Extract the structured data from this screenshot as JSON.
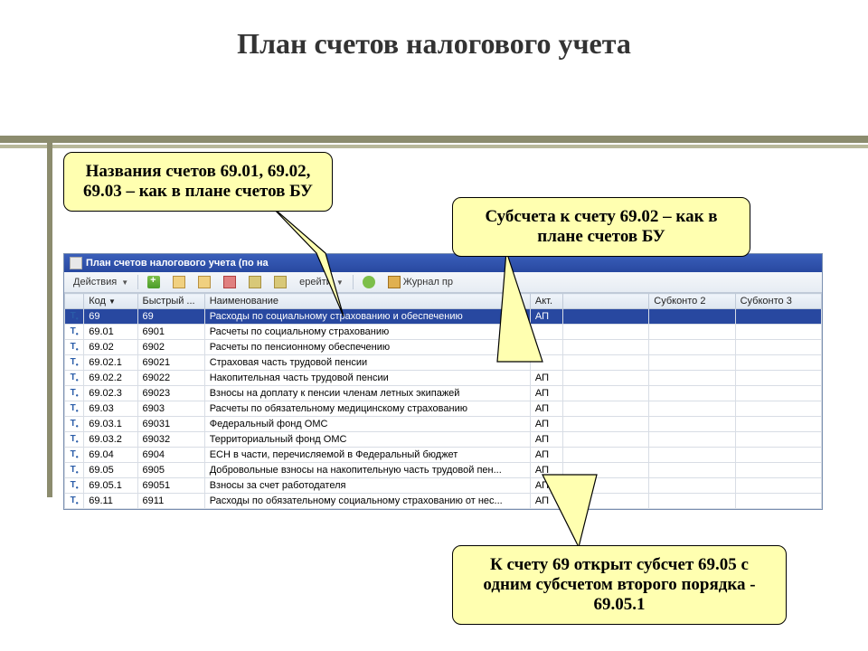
{
  "slide": {
    "title": "План счетов налогового учета"
  },
  "callouts": {
    "c1": "Названия счетов 69.01, 69.02, 69.03 – как в плане счетов БУ",
    "c2": "Субсчета к счету 69.02 – как в плане счетов БУ",
    "c3": "К счету 69 открыт субсчет 69.05 с одним субсчетом второго порядка - 69.05.1"
  },
  "window": {
    "title": "План счетов налогового учета (по на"
  },
  "toolbar": {
    "actions": "Действия",
    "goto": "ерейти",
    "journal": "Журнал пр"
  },
  "columns": {
    "icon": "",
    "kod": "Код",
    "bystr": "Быстрый ...",
    "naim": "Наименование",
    "akt": "Акт.",
    "sub1": "",
    "sub2": "Субконто 2",
    "sub3": "Субконто 3"
  },
  "rows": [
    {
      "kod": "69",
      "bystr": "69",
      "naim": "Расходы по социальному страхованию и обеспечению",
      "akt": "АП"
    },
    {
      "kod": "69.01",
      "bystr": "6901",
      "naim": "Расчеты по социальному страхованию",
      "akt": ""
    },
    {
      "kod": "69.02",
      "bystr": "6902",
      "naim": "Расчеты по пенсионному обеспечению",
      "akt": ""
    },
    {
      "kod": "69.02.1",
      "bystr": "69021",
      "naim": "Страховая часть трудовой пенсии",
      "akt": ""
    },
    {
      "kod": "69.02.2",
      "bystr": "69022",
      "naim": "Накопительная часть трудовой пенсии",
      "akt": "АП"
    },
    {
      "kod": "69.02.3",
      "bystr": "69023",
      "naim": "Взносы на доплату к пенсии членам летных экипажей",
      "akt": "АП"
    },
    {
      "kod": "69.03",
      "bystr": "6903",
      "naim": "Расчеты по обязательному медицинскому страхованию",
      "akt": "АП"
    },
    {
      "kod": "69.03.1",
      "bystr": "69031",
      "naim": "Федеральный фонд ОМС",
      "akt": "АП"
    },
    {
      "kod": "69.03.2",
      "bystr": "69032",
      "naim": "Территориальный фонд ОМС",
      "akt": "АП"
    },
    {
      "kod": "69.04",
      "bystr": "6904",
      "naim": "ЕСН в части, перечисляемой в Федеральный бюджет",
      "akt": "АП"
    },
    {
      "kod": "69.05",
      "bystr": "6905",
      "naim": "Добровольные взносы на накопительную часть трудовой пен...",
      "akt": "АП"
    },
    {
      "kod": "69.05.1",
      "bystr": "69051",
      "naim": "Взносы за счет работодателя",
      "akt": "АП"
    },
    {
      "kod": "69.11",
      "bystr": "6911",
      "naim": "Расходы по обязательному социальному страхованию от нес...",
      "akt": "АП"
    }
  ]
}
